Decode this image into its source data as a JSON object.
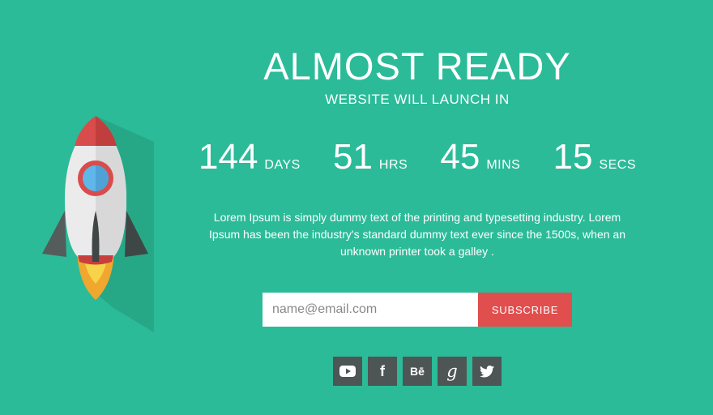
{
  "colors": {
    "background": "#2bbb98",
    "accent": "#e04e4e",
    "social": "#4e5555"
  },
  "hero": {
    "title": "ALMOST READY",
    "subtitle": "WEBSITE WILL LAUNCH IN"
  },
  "countdown": [
    {
      "value": "144",
      "unit": "DAYS"
    },
    {
      "value": "51",
      "unit": "HRS"
    },
    {
      "value": "45",
      "unit": "MINS"
    },
    {
      "value": "15",
      "unit": "SECS"
    }
  ],
  "description": "Lorem Ipsum is simply dummy text of the printing and typesetting industry. Lorem Ipsum has been the industry's standard dummy text ever since the 1500s, when an unknown printer took a galley .",
  "subscribe": {
    "placeholder": "name@email.com",
    "button_label": "SUBSCRIBE"
  },
  "social": [
    {
      "icon": "youtube-icon"
    },
    {
      "icon": "facebook-icon",
      "glyph": "f"
    },
    {
      "icon": "behance-icon",
      "glyph": "Bē"
    },
    {
      "icon": "google-icon",
      "glyph": "g"
    },
    {
      "icon": "twitter-icon"
    }
  ]
}
